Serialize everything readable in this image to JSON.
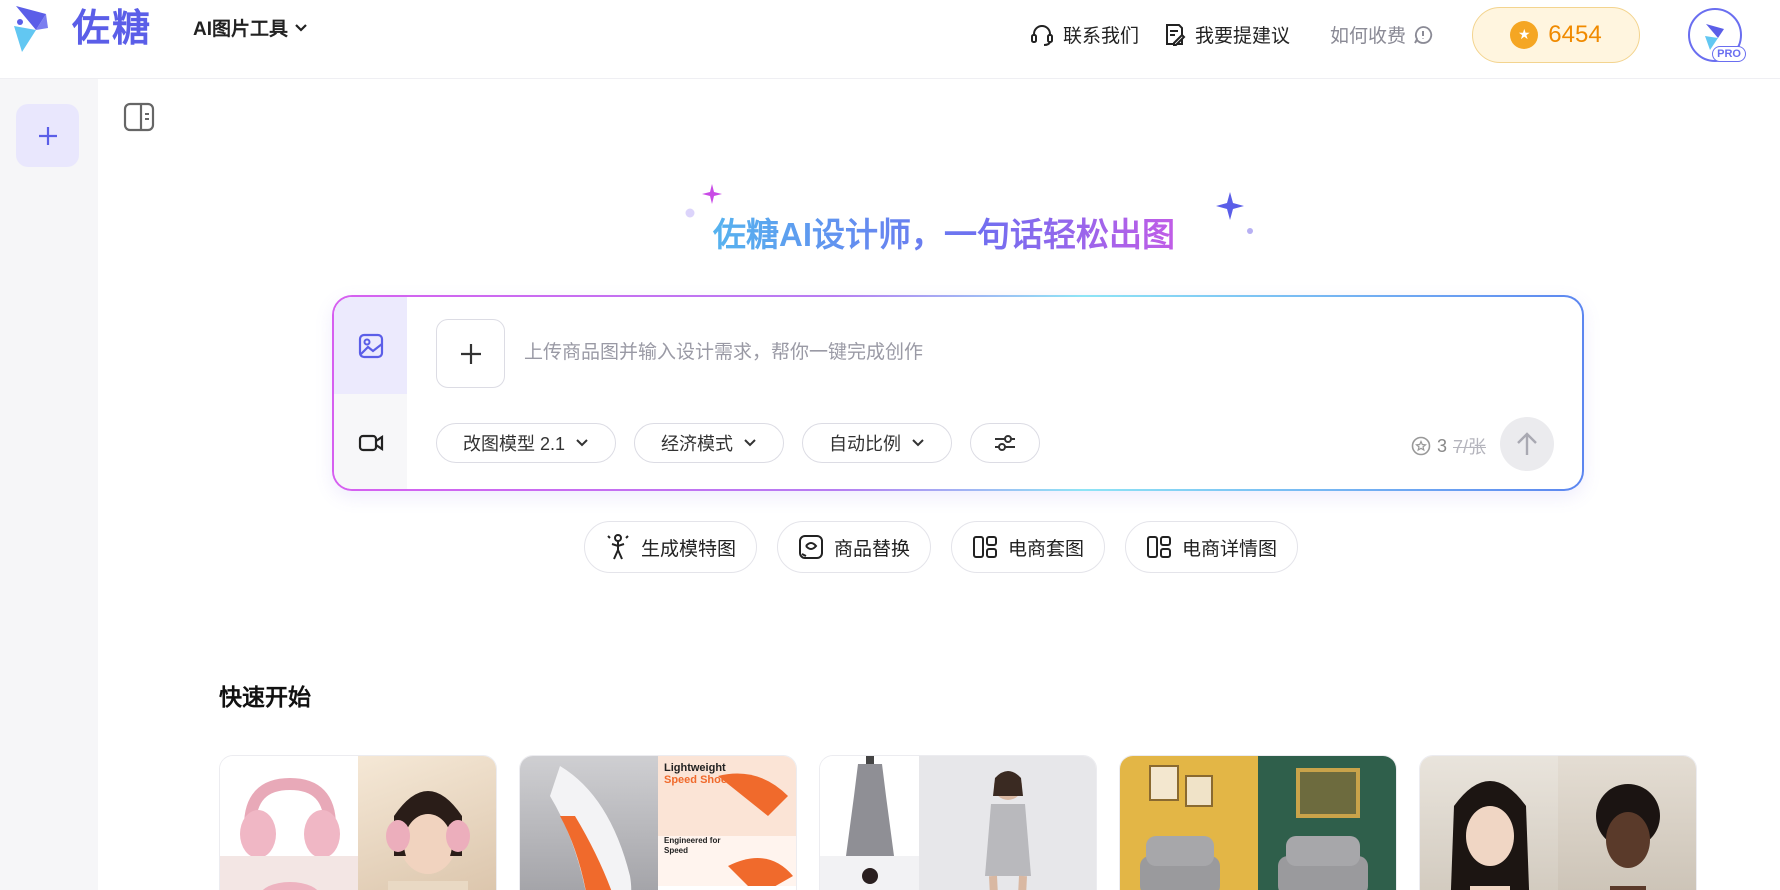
{
  "brand": {
    "name": "佐糖",
    "logo_icon": "zuotang-logo-icon",
    "accent": "#5b5ee8"
  },
  "header": {
    "tool_menu_label": "AI图片工具",
    "contact_label": "联系我们",
    "feedback_label": "我要提建议",
    "pricing_label": "如何收费",
    "coins": "6454",
    "avatar_badge": "PRO"
  },
  "hero": {
    "title": "佐糖AI设计师，一句话轻松出图"
  },
  "prompt": {
    "placeholder": "上传商品图并输入设计需求，帮你一键完成创作",
    "value": "",
    "options": [
      {
        "label": "改图模型 2.1"
      },
      {
        "label": "经济模式"
      },
      {
        "label": "自动比例"
      }
    ],
    "settings_icon": "sliders-icon",
    "cost_current": "3",
    "cost_original": "7/张"
  },
  "quick_tools": [
    {
      "label": "生成模特图",
      "icon": "model-pose-icon"
    },
    {
      "label": "商品替换",
      "icon": "product-swap-icon"
    },
    {
      "label": "电商套图",
      "icon": "grid-layout-icon"
    },
    {
      "label": "电商详情图",
      "icon": "grid-layout-icon"
    }
  ],
  "quick_start": {
    "title": "快速开始",
    "cards": [
      {
        "name": "pink-headphones"
      },
      {
        "name": "speed-shoes",
        "overlay_title": "Lightweight",
        "overlay_sub": "Speed Shoes",
        "overlay_tag": "Engineered for Speed"
      },
      {
        "name": "sequin-dress"
      },
      {
        "name": "gray-armchair"
      },
      {
        "name": "portrait-models"
      }
    ]
  },
  "colors": {
    "coin_bg": "#fff5df",
    "coin_text": "#f08a00",
    "gradient_start": "#d65ff0",
    "gradient_end": "#5c86f0"
  }
}
